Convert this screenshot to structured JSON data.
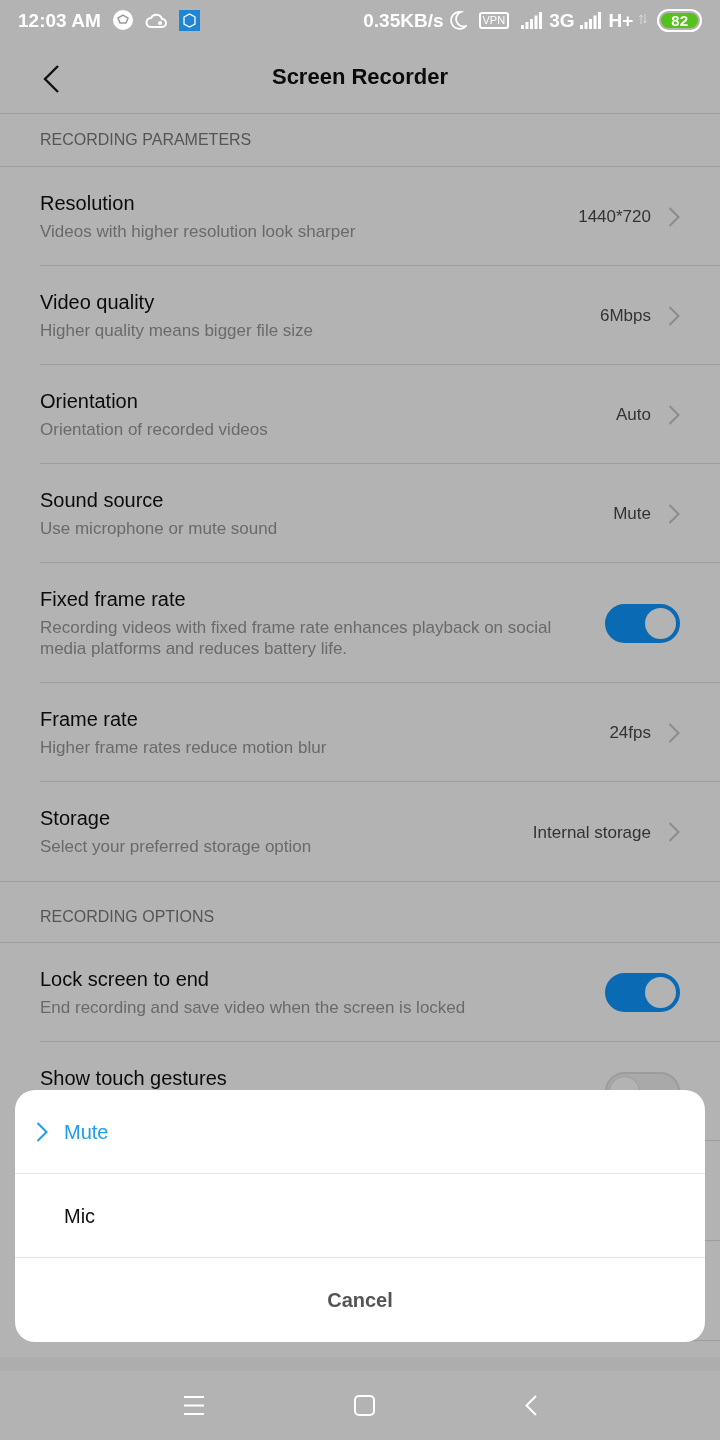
{
  "status_bar": {
    "time": "12:03 AM",
    "speed": "0.35KB/s",
    "vpn": "VPN",
    "network_1": "3G",
    "network_2": "H+",
    "battery": "82"
  },
  "header": {
    "title": "Screen Recorder"
  },
  "sections": [
    {
      "title": "RECORDING PARAMETERS",
      "items": [
        {
          "kind": "value",
          "title": "Resolution",
          "subtitle": "Videos with higher resolution look sharper",
          "value": "1440*720"
        },
        {
          "kind": "value",
          "title": "Video quality",
          "subtitle": "Higher quality means bigger file size",
          "value": "6Mbps"
        },
        {
          "kind": "value",
          "title": "Orientation",
          "subtitle": "Orientation of recorded videos",
          "value": "Auto"
        },
        {
          "kind": "value",
          "title": "Sound source",
          "subtitle": "Use microphone or mute sound",
          "value": "Mute"
        },
        {
          "kind": "toggle",
          "title": "Fixed frame rate",
          "subtitle": "Recording videos with fixed frame rate enhances playback on social media platforms and reduces battery life.",
          "on": true
        },
        {
          "kind": "value",
          "title": "Frame rate",
          "subtitle": "Higher frame rates reduce motion blur",
          "value": "24fps"
        },
        {
          "kind": "value",
          "title": "Storage",
          "subtitle": "Select your preferred storage option",
          "value": "Internal storage"
        }
      ]
    },
    {
      "title": "RECORDING OPTIONS",
      "items": [
        {
          "kind": "toggle",
          "title": "Lock screen to end",
          "subtitle": "End recording and save video when the screen is locked",
          "on": true
        },
        {
          "kind": "toggle",
          "title": "Show touch gestures",
          "on": false
        }
      ]
    }
  ],
  "sheet": {
    "options": [
      {
        "label": "Mute",
        "selected": true
      },
      {
        "label": "Mic",
        "selected": false
      }
    ],
    "cancel": "Cancel"
  }
}
